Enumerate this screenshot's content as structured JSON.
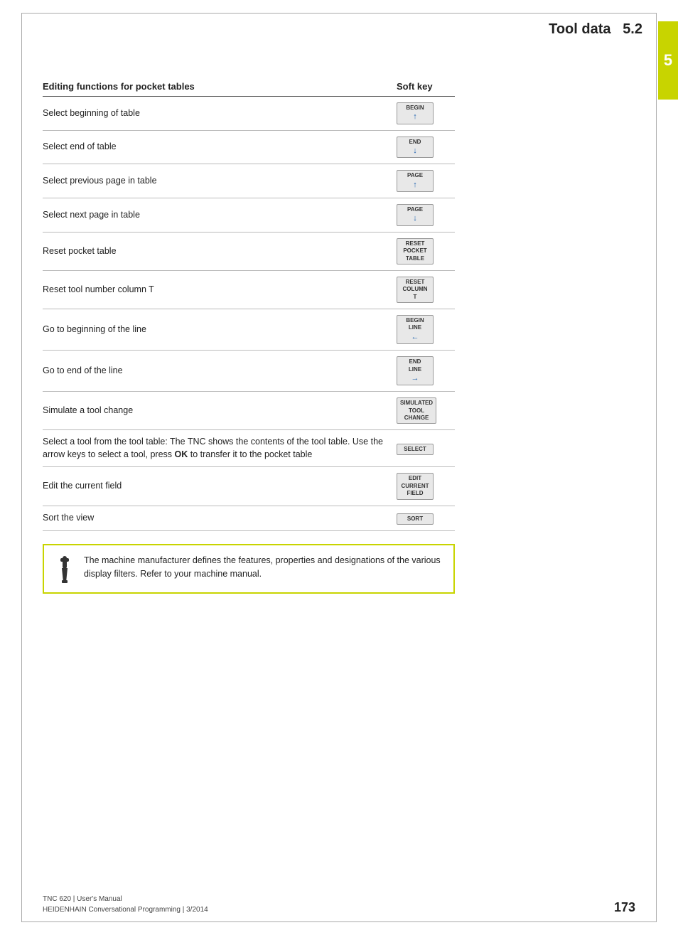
{
  "header": {
    "title": "Tool data",
    "section": "5.2",
    "chapter_number": "5"
  },
  "table": {
    "col1_header": "Editing functions for pocket tables",
    "col2_header": "Soft key",
    "rows": [
      {
        "description": "Select beginning of table",
        "softkey_lines": [
          "BEGIN",
          "↑"
        ],
        "softkey_label": "BEGIN ↑"
      },
      {
        "description": "Select end of table",
        "softkey_lines": [
          "END",
          "↓"
        ],
        "softkey_label": "END ↓"
      },
      {
        "description": "Select previous page in table",
        "softkey_lines": [
          "PAGE",
          "↑"
        ],
        "softkey_label": "PAGE ↑"
      },
      {
        "description": "Select next page in table",
        "softkey_lines": [
          "PAGE",
          "↓"
        ],
        "softkey_label": "PAGE ↓"
      },
      {
        "description": "Reset pocket table",
        "softkey_lines": [
          "RESET",
          "POCKET",
          "TABLE"
        ],
        "softkey_label": "RESET POCKET TABLE"
      },
      {
        "description": "Reset tool number column T",
        "softkey_lines": [
          "RESET",
          "COLUMN",
          "T"
        ],
        "softkey_label": "RESET COLUMN T"
      },
      {
        "description": "Go to beginning of the line",
        "softkey_lines": [
          "BEGIN",
          "LINE",
          "←"
        ],
        "softkey_label": "BEGIN LINE ←"
      },
      {
        "description": "Go to end of the line",
        "softkey_lines": [
          "END",
          "LINE",
          "→"
        ],
        "softkey_label": "END LINE →"
      },
      {
        "description": "Simulate a tool change",
        "softkey_lines": [
          "SIMULATED",
          "TOOL",
          "CHANGE"
        ],
        "softkey_label": "SIMULATED TOOL CHANGE"
      },
      {
        "description": "Select a tool from the tool table: The TNC shows the contents of the tool table. Use the arrow keys to select a tool, press OK to transfer it to the pocket table",
        "softkey_lines": [
          "SELECT"
        ],
        "softkey_label": "SELECT"
      },
      {
        "description": "Edit the current field",
        "softkey_lines": [
          "EDIT",
          "CURRENT",
          "FIELD"
        ],
        "softkey_label": "EDIT CURRENT FIELD"
      },
      {
        "description": "Sort the view",
        "softkey_lines": [
          "SORT"
        ],
        "softkey_label": "SORT"
      }
    ]
  },
  "note": {
    "text": "The machine manufacturer defines the features, properties and designations of the various display filters. Refer to your machine manual."
  },
  "footer": {
    "line1": "TNC 620 | User's Manual",
    "line2": "HEIDENHAIN Conversational Programming | 3/2014",
    "page_number": "173"
  }
}
